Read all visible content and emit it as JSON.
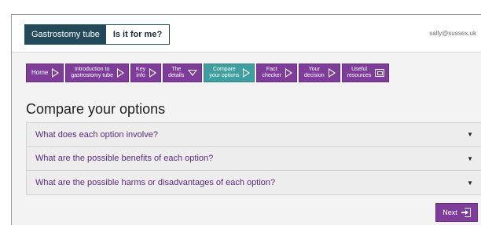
{
  "header": {
    "brand_main": "Gastrostomy tube",
    "brand_sub": "Is it for me?",
    "user_email": "sally@sussex.uk"
  },
  "nav": {
    "items": [
      {
        "line1": "Home",
        "line2": "",
        "icon": "triangle-right-icon"
      },
      {
        "line1": "Introduction to",
        "line2": "gastrostomy tube",
        "icon": "triangle-right-icon"
      },
      {
        "line1": "Key",
        "line2": "info",
        "icon": "triangle-right-icon"
      },
      {
        "line1": "The",
        "line2": "details",
        "icon": "triangle-down-icon"
      },
      {
        "line1": "Compare",
        "line2": "your options",
        "icon": "triangle-right-icon",
        "active": true
      },
      {
        "line1": "Fact",
        "line2": "checker",
        "icon": "triangle-right-icon"
      },
      {
        "line1": "Your",
        "line2": "decision",
        "icon": "triangle-right-icon"
      },
      {
        "line1": "Useful",
        "line2": "resources",
        "icon": "resources-icon"
      }
    ]
  },
  "main": {
    "title": "Compare your options",
    "accordion": [
      {
        "label": "What does each option involve?"
      },
      {
        "label": "What are the possible benefits of each option?"
      },
      {
        "label": "What are the possible harms or disadvantages of each option?"
      }
    ],
    "caret": "▼",
    "next_label": "Next"
  },
  "colors": {
    "nav_purple": "#7d3d99",
    "nav_active_teal": "#3f9ea0",
    "brand_dark": "#23495b",
    "link_purple": "#5b2a7e"
  }
}
